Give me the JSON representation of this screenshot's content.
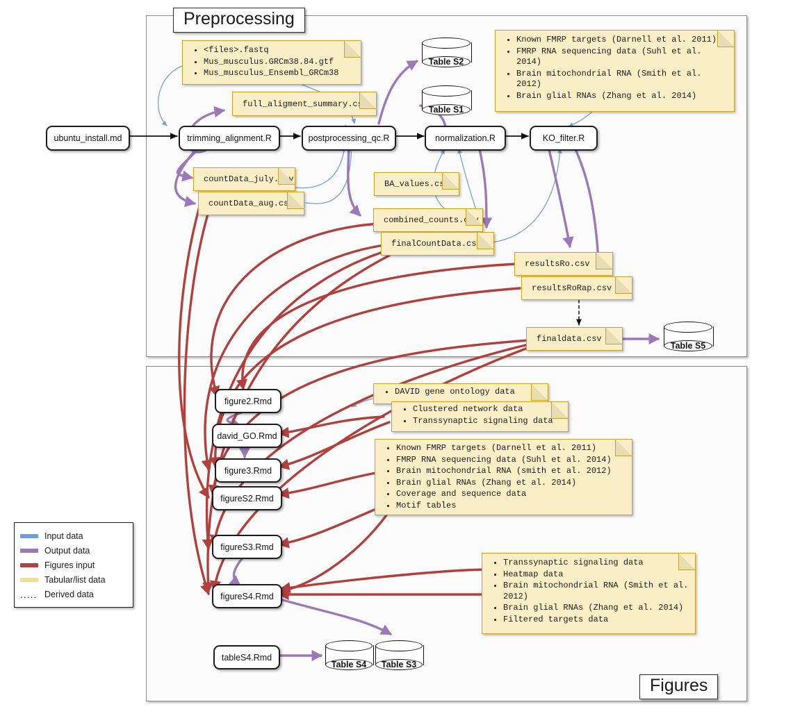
{
  "panels": {
    "preprocessing": {
      "label": "Preprocessing"
    },
    "figures": {
      "label": "Figures"
    }
  },
  "colors": {
    "input_data": "#6e9fd8",
    "output_data": "#9b79b8",
    "figures_input": "#b1403c",
    "tabular_list_data": "#f7dd92",
    "derived_data": "#1a1a1a",
    "note_fill": "#faeec6",
    "note_border": "#c9a227",
    "panel_border": "#8a8a8a",
    "node_border": "#1c1c1c"
  },
  "legend": {
    "items": [
      {
        "label": "Input data",
        "style": "solid",
        "color": "#6e9fd8"
      },
      {
        "label": "Output data",
        "style": "solid",
        "color": "#9b79b8"
      },
      {
        "label": "Figures input",
        "style": "solid",
        "color": "#b1403c"
      },
      {
        "label": "Tabular/list data",
        "style": "solid",
        "color": "#f7dd92"
      },
      {
        "label": "Derived data",
        "style": "dotted",
        "color": "#1a1a1a"
      }
    ]
  },
  "entry_node": {
    "label": "ubuntu_install.md"
  },
  "preprocessing": {
    "scripts": [
      {
        "label": "trimming_alignment.R"
      },
      {
        "label": "postprocessing_qc.R"
      },
      {
        "label": "normalization.R"
      },
      {
        "label": "KO_filter.R"
      }
    ],
    "notes": {
      "inputs_fastq": {
        "items": [
          "<files>.fastq",
          "Mus_musculus.GRCm38.84.gtf",
          "Mus_musculus_Ensembl_GRCm38"
        ]
      },
      "full_alignment_summary": {
        "label": "full_aligment_summary.csv"
      },
      "external_sources": {
        "items": [
          "Known FMRP targets (Darnell et al. 2011)",
          "FMRP RNA sequencing data (Suhl et al. 2014)",
          "Brain mitochondrial RNA (Smith et al. 2012)",
          "Brain glial RNAs (Zhang et al. 2014)"
        ]
      },
      "countData_july": {
        "label": "countData_july.csv"
      },
      "countData_aug": {
        "label": "countData_aug.csv"
      },
      "ba_values": {
        "label": "BA_values.csv"
      },
      "combined_counts": {
        "label": "combined_counts.csv"
      },
      "final_count_data": {
        "label": "finalCountData.csv"
      },
      "results_ro": {
        "label": "resultsRo.csv"
      },
      "results_ro_rap": {
        "label": "resultsRoRap.csv"
      },
      "finaldata": {
        "label": "finaldata.csv"
      }
    },
    "tables": [
      {
        "label": "Table S2"
      },
      {
        "label": "Table S1"
      },
      {
        "label": "Table S5"
      }
    ]
  },
  "figures": {
    "scripts": [
      {
        "label": "figure2.Rmd"
      },
      {
        "label": "david_GO.Rmd"
      },
      {
        "label": "figure3.Rmd"
      },
      {
        "label": "figureS2.Rmd"
      },
      {
        "label": "figureS3.Rmd"
      },
      {
        "label": "figureS4.Rmd"
      },
      {
        "label": "tableS4.Rmd"
      }
    ],
    "notes": {
      "david_data": {
        "items": [
          "DAVID gene ontology data"
        ]
      },
      "clustered_network": {
        "items": [
          "Clustered network data",
          "Transsynaptic signaling data"
        ]
      },
      "fmrp_sources": {
        "items": [
          "Known FMRP targets (Darnell et al. 2011)",
          "FMRP RNA sequencing data (Suhl et al. 2014)",
          "Brain mitochondrial RNA (smith et al. 2012)",
          "Brain glial RNAs (Zhang et al. 2014)",
          "Coverage and sequence data",
          "Motif tables"
        ]
      },
      "heatmap_sources": {
        "items": [
          "Transsynaptic signaling data",
          "Heatmap data",
          "Brain mitochondrial RNA (Smith et al. 2012)",
          "Brain glial RNAs (Zhang et al. 2014)",
          "Filtered targets data"
        ]
      }
    },
    "tables": [
      {
        "label": "Table S4"
      },
      {
        "label": "Table S3"
      }
    ]
  }
}
